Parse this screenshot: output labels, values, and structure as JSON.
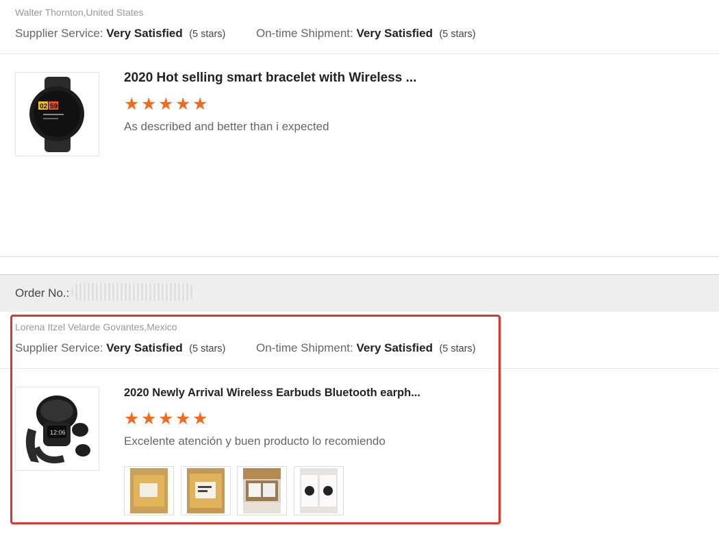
{
  "review1": {
    "reviewer": "Walter Thornton,United States",
    "supplier_label": "Supplier Service:",
    "supplier_value": "Very Satisfied",
    "supplier_stars": "(5 stars)",
    "shipment_label": "On-time Shipment:",
    "shipment_value": "Very Satisfied",
    "shipment_stars": "(5 stars)",
    "product_title": "2020 Hot selling smart bracelet with Wireless ...",
    "product_thumb_icon": "smartwatch-icon",
    "rating": 5,
    "comment": "As described and better than i expected"
  },
  "order": {
    "label": "Order No.:"
  },
  "review2": {
    "reviewer": "Lorena Itzel Velarde Govantes,Mexico",
    "supplier_label": "Supplier Service:",
    "supplier_value": "Very Satisfied",
    "supplier_stars": "(5 stars)",
    "shipment_label": "On-time Shipment:",
    "shipment_value": "Very Satisfied",
    "shipment_stars": "(5 stars)",
    "product_title": "2020 Newly Arrival Wireless Earbuds Bluetooth earph...",
    "product_thumb_icon": "earbuds-watch-icon",
    "rating": 5,
    "comment": "Excelente atención y buen producto lo recomiendo",
    "photos": [
      "package-photo-icon",
      "package-label-photo-icon",
      "open-box-photo-icon",
      "earbuds-photo-icon"
    ]
  },
  "colors": {
    "star": "#f46a1c",
    "highlight": "#e0342f",
    "order_bar": "#eeeeee"
  }
}
